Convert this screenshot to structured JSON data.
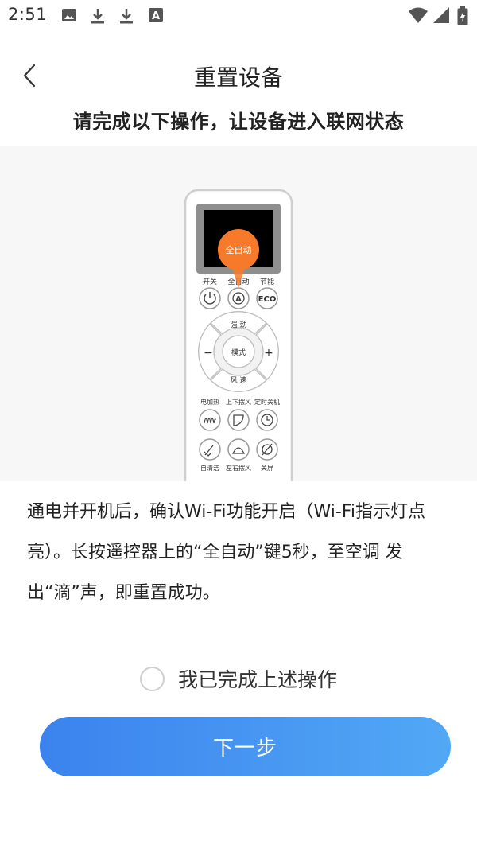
{
  "status_bar": {
    "time": "2:51",
    "left_icons": [
      "image-icon",
      "download-icon",
      "download-icon",
      "a-letter-icon"
    ],
    "right_icons": [
      "wifi-icon",
      "signal-icon",
      "battery-icon"
    ]
  },
  "header": {
    "title": "重置设备",
    "back_icon": "chevron-left-icon"
  },
  "subtitle": "请完成以下操作，让设备进入联网状态",
  "illustration": {
    "highlight_label": "全自动",
    "top_labels": [
      "开关",
      "全自动",
      "节能"
    ],
    "eco_label": "ECO",
    "dpad": {
      "up": "强 劲",
      "center": "模式",
      "down": "风 速",
      "left": "−",
      "right": "+"
    },
    "row3_labels": [
      "电加热",
      "上下摆风",
      "定时关机"
    ],
    "row4_labels": [
      "自清洁",
      "左右摆风",
      "关屏"
    ],
    "colors": {
      "highlight": "#f77a2b",
      "screen": "#000000",
      "bezel": "#8e8e8e"
    }
  },
  "instruction": "通电并开机后，确认Wi-Fi功能开启（Wi-Fi指示灯点亮）。长按遥控器上的“全自动”键5秒，至空调 发出“滴”声，即重置成功。",
  "confirm": {
    "label": "我已完成上述操作",
    "checked": false
  },
  "next_button": {
    "label": "下一步",
    "colors": {
      "start": "#3b82ee",
      "end": "#52a8f5"
    }
  }
}
